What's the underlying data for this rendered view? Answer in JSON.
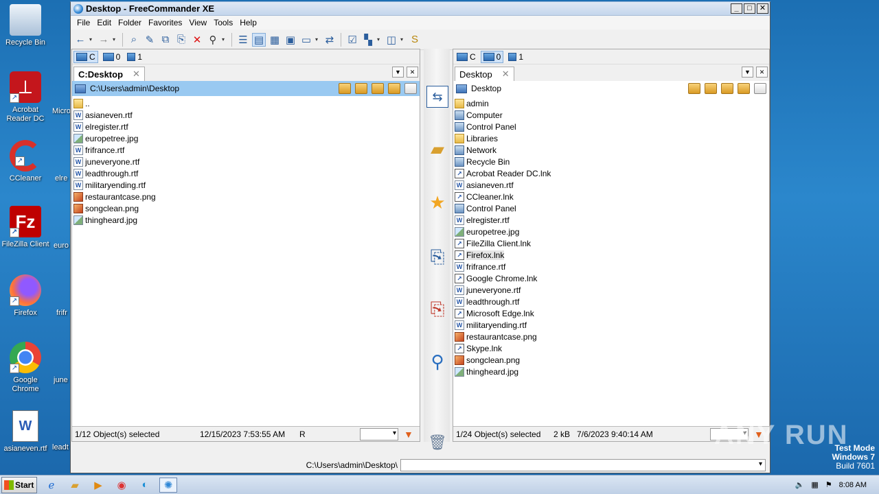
{
  "desktop": {
    "icons": [
      {
        "label": "Recycle Bin",
        "name": "recycle-bin-icon"
      },
      {
        "label": "Acrobat Reader DC",
        "name": "acrobat-reader-icon"
      },
      {
        "label": "CCleaner",
        "name": "ccleaner-icon"
      },
      {
        "label": "FileZilla Client",
        "name": "filezilla-icon"
      },
      {
        "label": "Firefox",
        "name": "firefox-icon"
      },
      {
        "label": "Google Chrome",
        "name": "chrome-icon"
      },
      {
        "label": "asianeven.rtf",
        "name": "word-doc-icon"
      }
    ],
    "partial_labels": [
      "Micro",
      "elre",
      "euro",
      "frifr",
      "june",
      "leadt"
    ]
  },
  "window": {
    "title": "Desktop - FreeCommander XE",
    "menu": [
      "File",
      "Edit",
      "Folder",
      "Favorites",
      "View",
      "Tools",
      "Help"
    ]
  },
  "left_panel": {
    "drives": [
      "C",
      "0",
      "1"
    ],
    "tab_label": "C:Desktop",
    "path": "C:\\Users\\admin\\Desktop",
    "files": [
      {
        "name": "..",
        "type": "folder"
      },
      {
        "name": "asianeven.rtf",
        "type": "doc"
      },
      {
        "name": "elregister.rtf",
        "type": "doc"
      },
      {
        "name": "europetree.jpg",
        "type": "img"
      },
      {
        "name": "frifrance.rtf",
        "type": "doc"
      },
      {
        "name": "juneveryone.rtf",
        "type": "doc"
      },
      {
        "name": "leadthrough.rtf",
        "type": "doc"
      },
      {
        "name": "militaryending.rtf",
        "type": "doc"
      },
      {
        "name": "restaurantcase.png",
        "type": "png"
      },
      {
        "name": "songclean.png",
        "type": "png"
      },
      {
        "name": "thingheard.jpg",
        "type": "img"
      }
    ],
    "status": {
      "selected": "1/12 Object(s) selected",
      "date": "12/15/2023 7:53:55 AM",
      "attr": "R"
    }
  },
  "right_panel": {
    "drives": [
      "C",
      "0",
      "1"
    ],
    "tab_label": "Desktop",
    "path": "Desktop",
    "files": [
      {
        "name": "admin",
        "type": "folder"
      },
      {
        "name": "Computer",
        "type": "sys"
      },
      {
        "name": "Control Panel",
        "type": "sys"
      },
      {
        "name": "Libraries",
        "type": "folder"
      },
      {
        "name": "Network",
        "type": "sys"
      },
      {
        "name": "Recycle Bin",
        "type": "sys"
      },
      {
        "name": "Acrobat Reader DC.lnk",
        "type": "lnk"
      },
      {
        "name": "asianeven.rtf",
        "type": "doc"
      },
      {
        "name": "CCleaner.lnk",
        "type": "lnk"
      },
      {
        "name": "Control Panel",
        "type": "sys"
      },
      {
        "name": "elregister.rtf",
        "type": "doc"
      },
      {
        "name": "europetree.jpg",
        "type": "img"
      },
      {
        "name": "FileZilla Client.lnk",
        "type": "lnk"
      },
      {
        "name": "Firefox.lnk",
        "type": "lnk",
        "hover": true
      },
      {
        "name": "frifrance.rtf",
        "type": "doc"
      },
      {
        "name": "Google Chrome.lnk",
        "type": "lnk"
      },
      {
        "name": "juneveryone.rtf",
        "type": "doc"
      },
      {
        "name": "leadthrough.rtf",
        "type": "doc"
      },
      {
        "name": "Microsoft Edge.lnk",
        "type": "lnk"
      },
      {
        "name": "militaryending.rtf",
        "type": "doc"
      },
      {
        "name": "restaurantcase.png",
        "type": "png"
      },
      {
        "name": "Skype.lnk",
        "type": "lnk"
      },
      {
        "name": "songclean.png",
        "type": "png"
      },
      {
        "name": "thingheard.jpg",
        "type": "img"
      }
    ],
    "status": {
      "selected": "1/24 Object(s) selected",
      "size": "2 kB",
      "date": "7/6/2023 9:40:14 AM"
    }
  },
  "cmdline": {
    "path": "C:\\Users\\admin\\Desktop\\"
  },
  "taskbar": {
    "start": "Start",
    "time": "8:08 AM"
  },
  "overlay": {
    "watermark": "ANY RUN",
    "testmode": [
      "Test Mode",
      "Windows 7",
      "Build 7601"
    ]
  }
}
